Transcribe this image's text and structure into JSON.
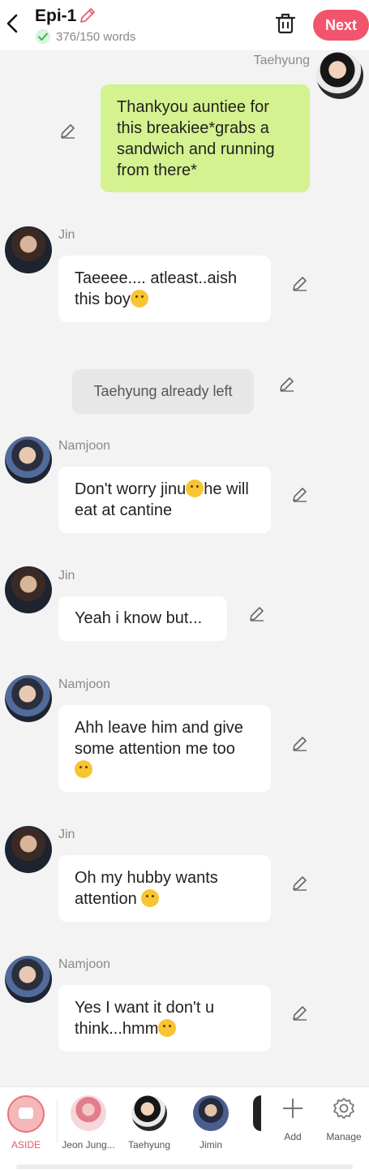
{
  "header": {
    "title": "Epi-1",
    "word_count": "376/150 words",
    "next_label": "Next"
  },
  "messages": [
    {
      "speaker": "Taehyung",
      "text": "Thankyou auntiee for this breakiee*grabs a sandwich and running from there*"
    },
    {
      "speaker": "Jin",
      "text": "Taeeee.... atleast..aish this boy"
    },
    {
      "text": "Taehyung already left"
    },
    {
      "speaker": "Namjoon",
      "text_a": "Don't worry jinu",
      "text_b": "he will eat at cantine"
    },
    {
      "speaker": "Jin",
      "text": "Yeah i know but..."
    },
    {
      "speaker": "Namjoon",
      "text": "Ahh leave him and give some attention me too"
    },
    {
      "speaker": "Jin",
      "text": "Oh my hubby wants attention"
    },
    {
      "speaker": "Namjoon",
      "text": "Yes I want it don't u think...hmm"
    }
  ],
  "bottom_bar": {
    "aside_label": "ASIDE",
    "characters": [
      "Jeon Jung...",
      "Taehyung",
      "Jimin"
    ],
    "add_label": "Add",
    "manage_label": "Manage"
  }
}
